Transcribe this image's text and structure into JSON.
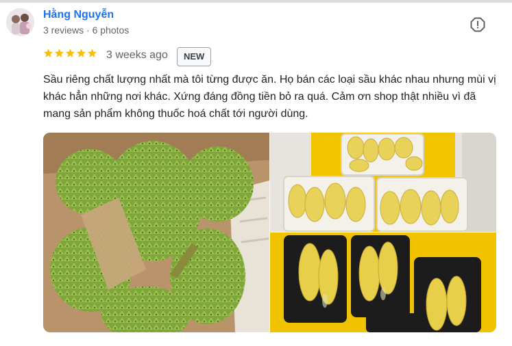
{
  "review": {
    "author_name": "Hằng Nguyễn",
    "author_meta": "3 reviews · 6 photos",
    "rating": 5,
    "rating_max": 5,
    "time_ago": "3 weeks ago",
    "badge": "NEW",
    "text": "Sầu riêng chất lượng nhất mà tôi từng được ăn. Họ bán các loại sầu khác nhau nhưng mùi vị khác hẳn những nơi khác. Xứng đáng đồng tiền bỏ ra quá. Cảm ơn shop thật nhiều vì đã mang sản phẩm không thuốc hoá chất tới người dùng."
  },
  "icons": {
    "star": "star-icon",
    "flag": "report-flag-icon"
  },
  "colors": {
    "author_link": "#1a73e8",
    "star": "#fbbc04",
    "secondary_text": "#5f6368"
  }
}
